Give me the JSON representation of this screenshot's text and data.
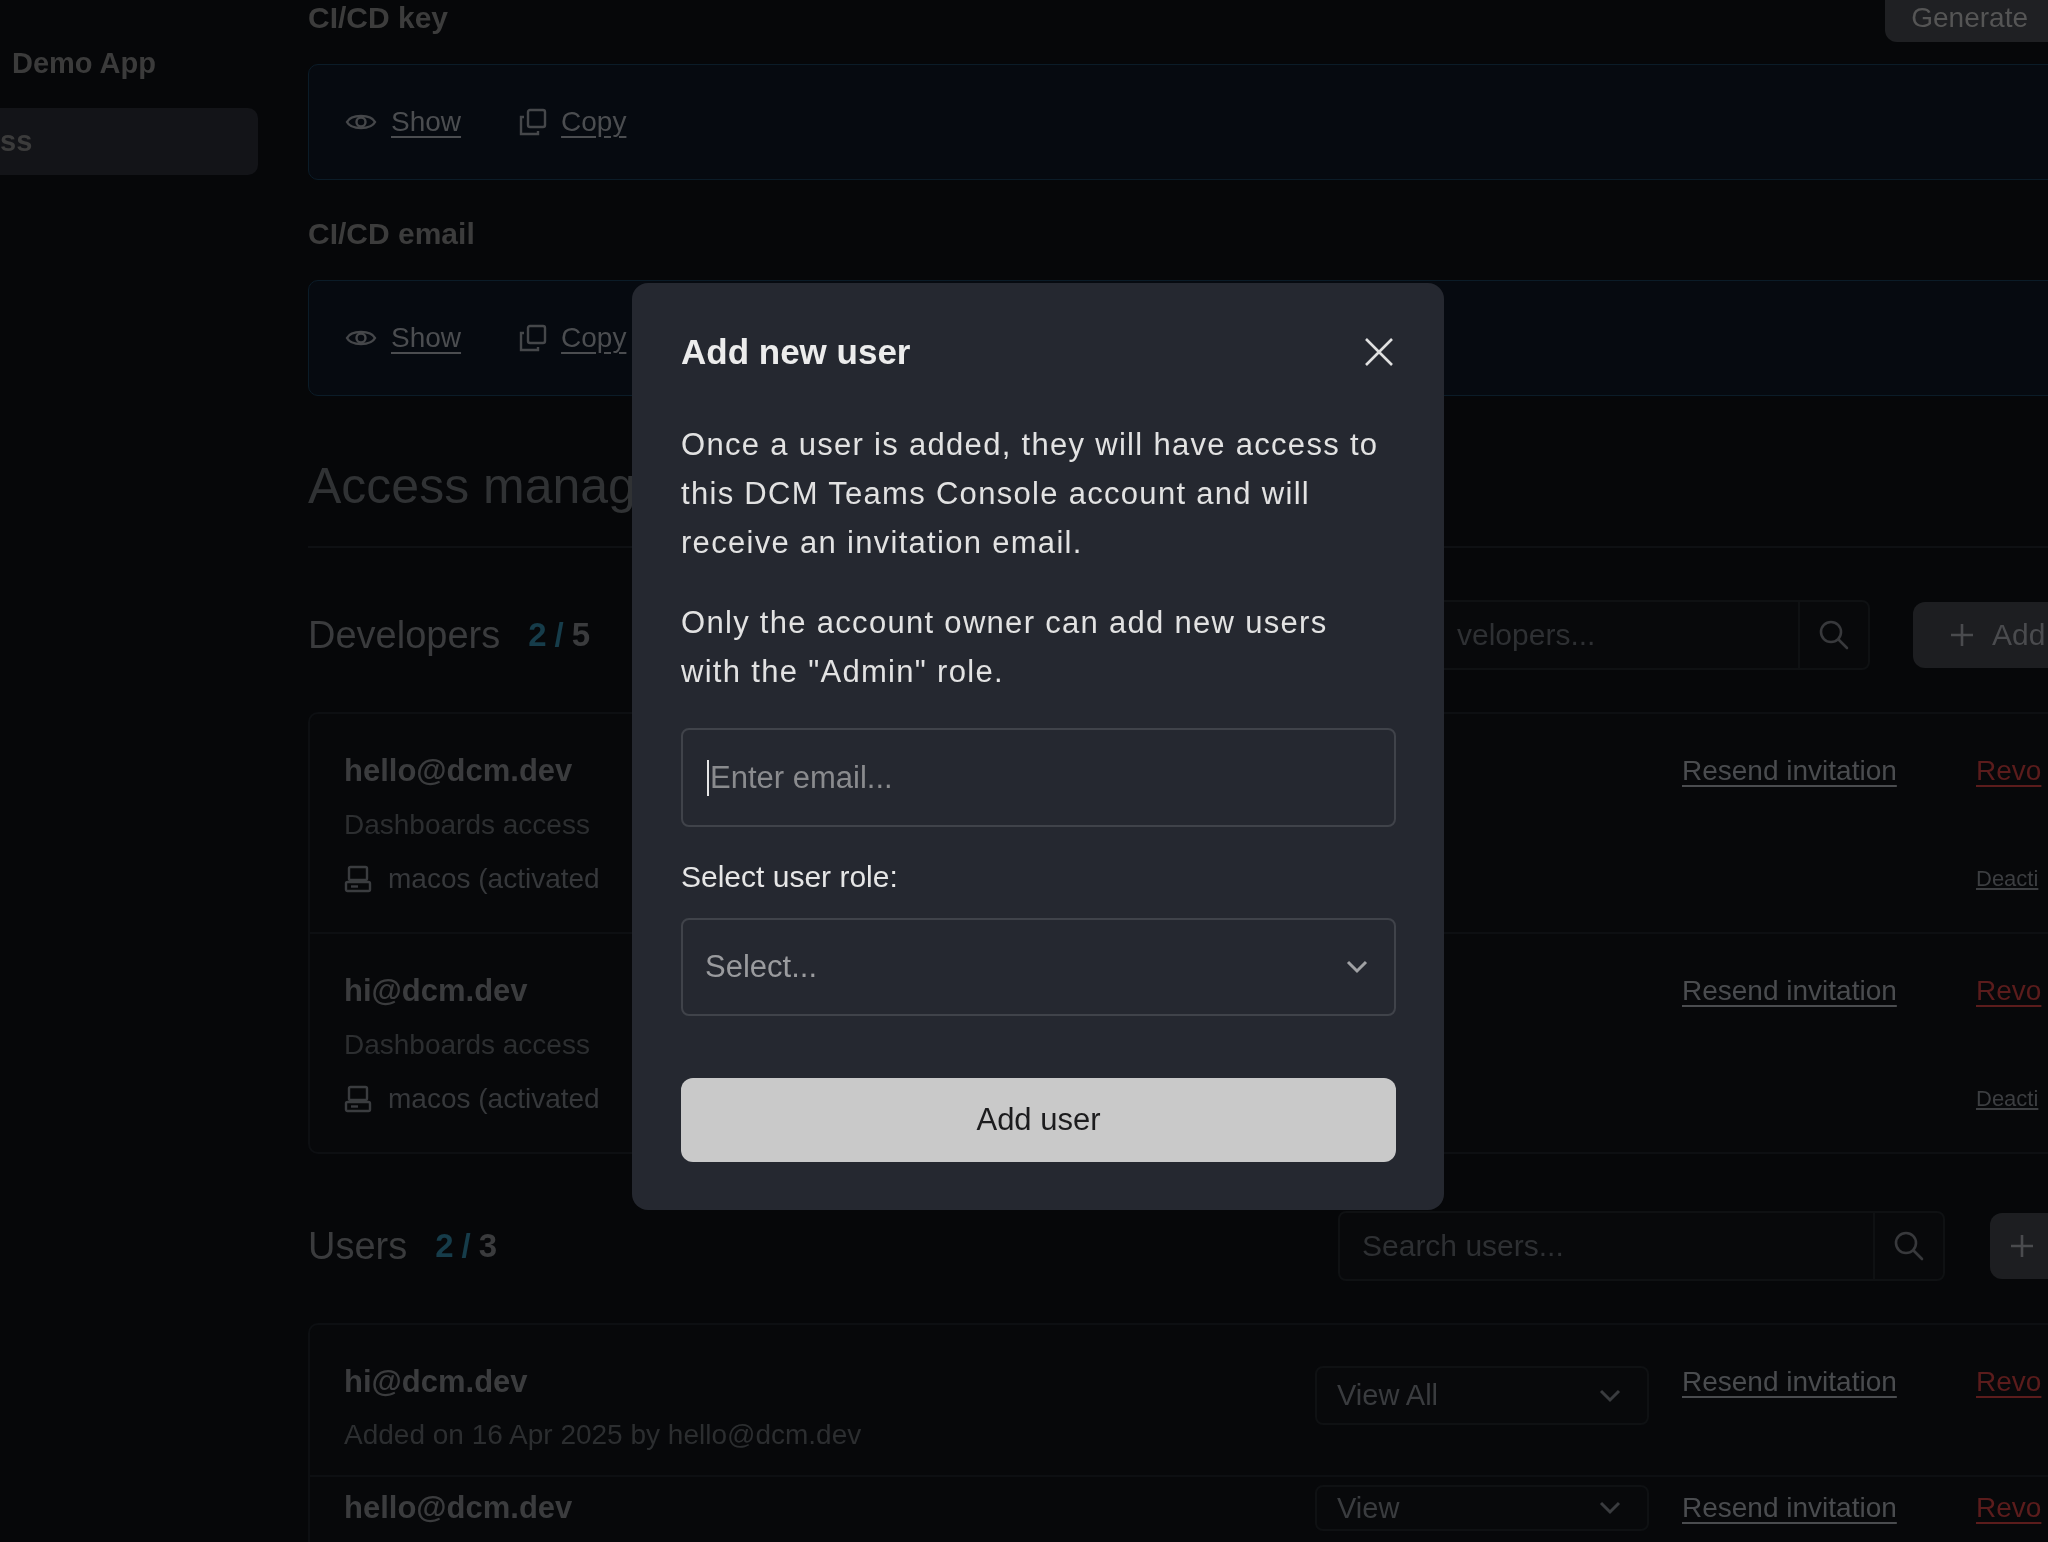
{
  "sidebar": {
    "app_name": "Demo App",
    "items": [
      {
        "label": "ss",
        "selected": true
      }
    ]
  },
  "cicd_key": {
    "label": "CI/CD key",
    "actions": [
      "Show",
      "Copy"
    ]
  },
  "generate_button": "Generate",
  "cicd_email": {
    "label": "CI/CD email",
    "actions": [
      "Show",
      "Copy"
    ]
  },
  "access_heading": "Access manag",
  "developers": {
    "title": "Developers",
    "used": "2",
    "separator": "/",
    "limit": "5",
    "search_placeholder": "velopers...",
    "add_button": "Add",
    "members": [
      {
        "email": "hello@dcm.dev",
        "access": "Dashboards access",
        "device": "macos (activated",
        "resend": "Resend invitation",
        "revoke": "Revo",
        "deactivate": "Deacti"
      },
      {
        "email": "hi@dcm.dev",
        "access": "Dashboards access",
        "device": "macos (activated",
        "resend": "Resend invitation",
        "revoke": "Revo",
        "deactivate": "Deacti"
      }
    ]
  },
  "users": {
    "title": "Users",
    "used": "2",
    "separator": "/",
    "limit": "3",
    "search_placeholder": "Search users...",
    "members": [
      {
        "email": "hi@dcm.dev",
        "added": "Added on 16 Apr 2025 by hello@dcm.dev",
        "role": "View All",
        "resend": "Resend invitation",
        "revoke": "Revo"
      },
      {
        "email": "hello@dcm.dev",
        "role": "View",
        "resend": "Resend invitation",
        "revoke": "Revo"
      }
    ]
  },
  "modal": {
    "title": "Add new user",
    "paragraphs": [
      "Once a user is added, they will have access to this DCM Teams Console account and will receive an invitation email.",
      "Only the account owner can add new users with the \"Admin\" role."
    ],
    "email_placeholder": "Enter email...",
    "email_focused": true,
    "role_label": "Select user role:",
    "role_placeholder": "Select...",
    "submit": "Add user"
  }
}
